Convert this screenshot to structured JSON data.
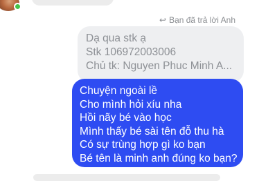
{
  "reply_notice": {
    "icon": "reply-arrow-icon",
    "text": "Bạn đã trả lời Anh"
  },
  "quoted_message": {
    "lines": [
      "Dạ qua stk ạ",
      "Stk 106972003006",
      "Chủ tk: Nguyen Phuc Minh A..."
    ]
  },
  "message": {
    "lines": [
      "Chuyện ngoài lề",
      "Cho mình hỏi xíu nha",
      "Hồi nãy bé vào học",
      "Mình thấy bé sài tên đỗ thu hà",
      "Có sự trùng hợp gì ko bạn",
      "Bé tên là minh anh đúng ko bạn?"
    ]
  },
  "colors": {
    "sent_bubble": "#2e4cf2",
    "quoted_bubble": "#eeeff1",
    "online": "#44c44a"
  }
}
